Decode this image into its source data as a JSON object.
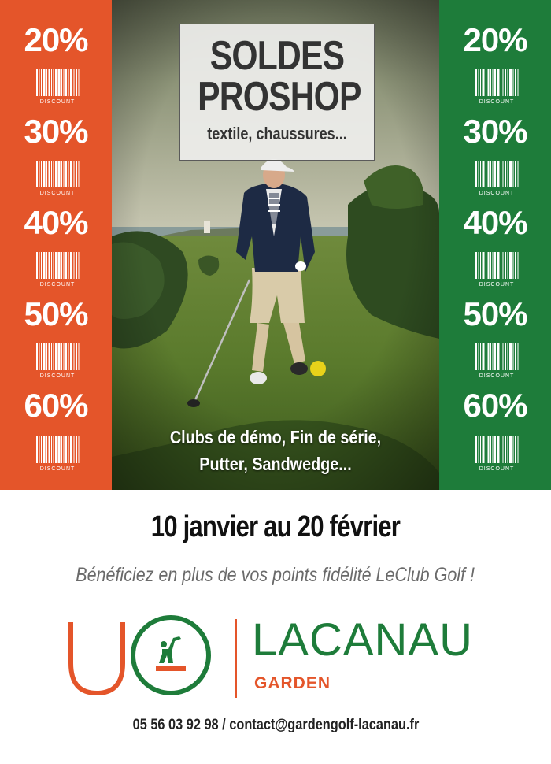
{
  "left_column": {
    "color": "#e4552a",
    "discounts": [
      "20%",
      "30%",
      "40%",
      "50%",
      "60%"
    ],
    "barcode_label": "DISCOUNT"
  },
  "right_column": {
    "color": "#1e7c3a",
    "discounts": [
      "20%",
      "30%",
      "40%",
      "50%",
      "60%"
    ],
    "barcode_label": "DISCOUNT"
  },
  "headline": {
    "line1": "SOLDES",
    "line2": "PROSHOP",
    "subtitle": "textile, chaussures..."
  },
  "promo": {
    "line1": "Clubs de démo, Fin de série,",
    "line2": "Putter, Sandwedge..."
  },
  "dates": "10 janvier au 20 février",
  "benefit": "Bénéficiez en plus de vos points fidélité LeClub Golf !",
  "logo": {
    "name": "LACANAU",
    "subname": "GARDEN",
    "green": "#1e7c3a",
    "orange": "#e4552a"
  },
  "contact": "05 56 03 92 98 / contact@gardengolf-lacanau.fr"
}
